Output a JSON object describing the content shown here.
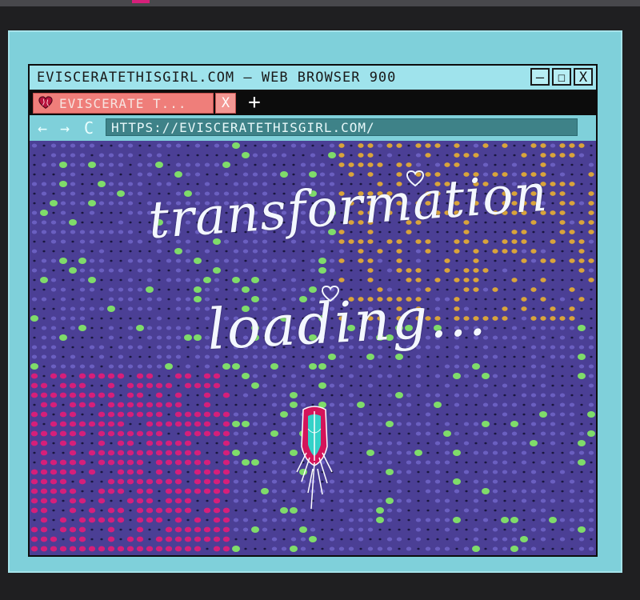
{
  "window": {
    "title": "EVISCERATETHISGIRL.COM — WEB BROWSER 900",
    "buttons": {
      "minimize": "—",
      "maximize": "☐",
      "close": "X"
    }
  },
  "tabs": [
    {
      "label": "EVISCERATE T...",
      "close": "X",
      "favicon": "heart-icon"
    }
  ],
  "new_tab_label": "+",
  "addressbar": {
    "back": "←",
    "forward": "→",
    "reload": "C",
    "url": "HTTPS://EVISCERATETHISGIRL.COM/"
  },
  "content": {
    "line1": "transformation",
    "line2": "loading...",
    "figure": "chrysalis-icon"
  },
  "colors": {
    "frame": "#7fd0da",
    "titlebar": "#9fe3ec",
    "tab": "#ef7e7a",
    "page_purple": "#4b3f95",
    "dot_green": "#7fdc6a",
    "dot_magenta": "#d61f7a",
    "dot_orange": "#d9a43b"
  }
}
